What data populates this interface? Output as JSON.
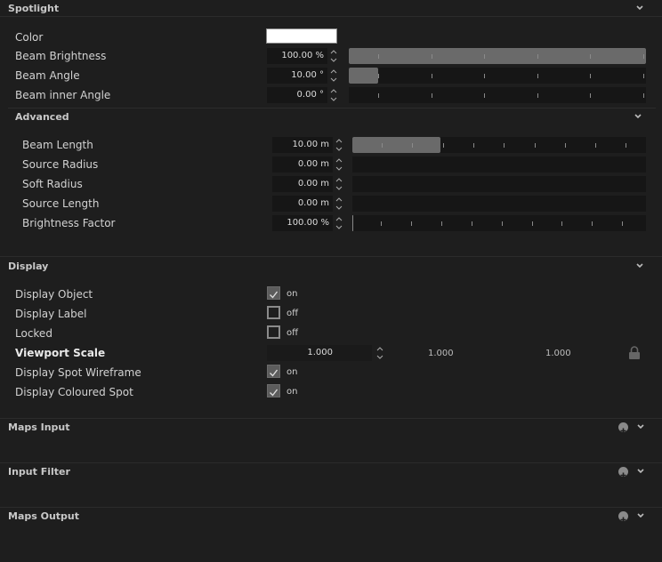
{
  "spotlight": {
    "title": "Spotlight",
    "color_label": "Color",
    "color_value": "#ffffff",
    "rows": [
      {
        "label": "Beam Brightness",
        "value": "100.00 %",
        "fill": 1.0
      },
      {
        "label": "Beam Angle",
        "value": "10.00 °",
        "fill": 0.1
      },
      {
        "label": "Beam inner Angle",
        "value": "0.00 °",
        "fill": 0.0
      }
    ]
  },
  "advanced": {
    "title": "Advanced",
    "rows": [
      {
        "label": "Beam Length",
        "value": "10.00 m",
        "fill": 0.3
      },
      {
        "label": "Source Radius",
        "value": "0.00 m",
        "fill": 0.0
      },
      {
        "label": "Soft Radius",
        "value": "0.00 m",
        "fill": 0.0
      },
      {
        "label": "Source Length",
        "value": "0.00 m",
        "fill": 0.0
      },
      {
        "label": "Brightness Factor",
        "value": "100.00 %",
        "fill": 0.0
      }
    ]
  },
  "display": {
    "title": "Display",
    "rows": [
      {
        "label": "Display Object",
        "state": "on",
        "checked": true
      },
      {
        "label": "Display Label",
        "state": "off",
        "checked": false
      },
      {
        "label": "Locked",
        "state": "off",
        "checked": false
      }
    ],
    "viewport": {
      "label": "Viewport Scale",
      "x": "1.000",
      "y": "1.000",
      "z": "1.000"
    },
    "rows2": [
      {
        "label": "Display Spot Wireframe",
        "state": "on",
        "checked": true
      },
      {
        "label": "Display Coloured Spot",
        "state": "on",
        "checked": true
      }
    ]
  },
  "collapsed": [
    {
      "title": "Maps Input"
    },
    {
      "title": "Input Filter"
    },
    {
      "title": "Maps Output"
    }
  ],
  "colors": {
    "background": "#1e1e1e",
    "field": "#161616",
    "slider_fill": "#6a6a6a"
  }
}
